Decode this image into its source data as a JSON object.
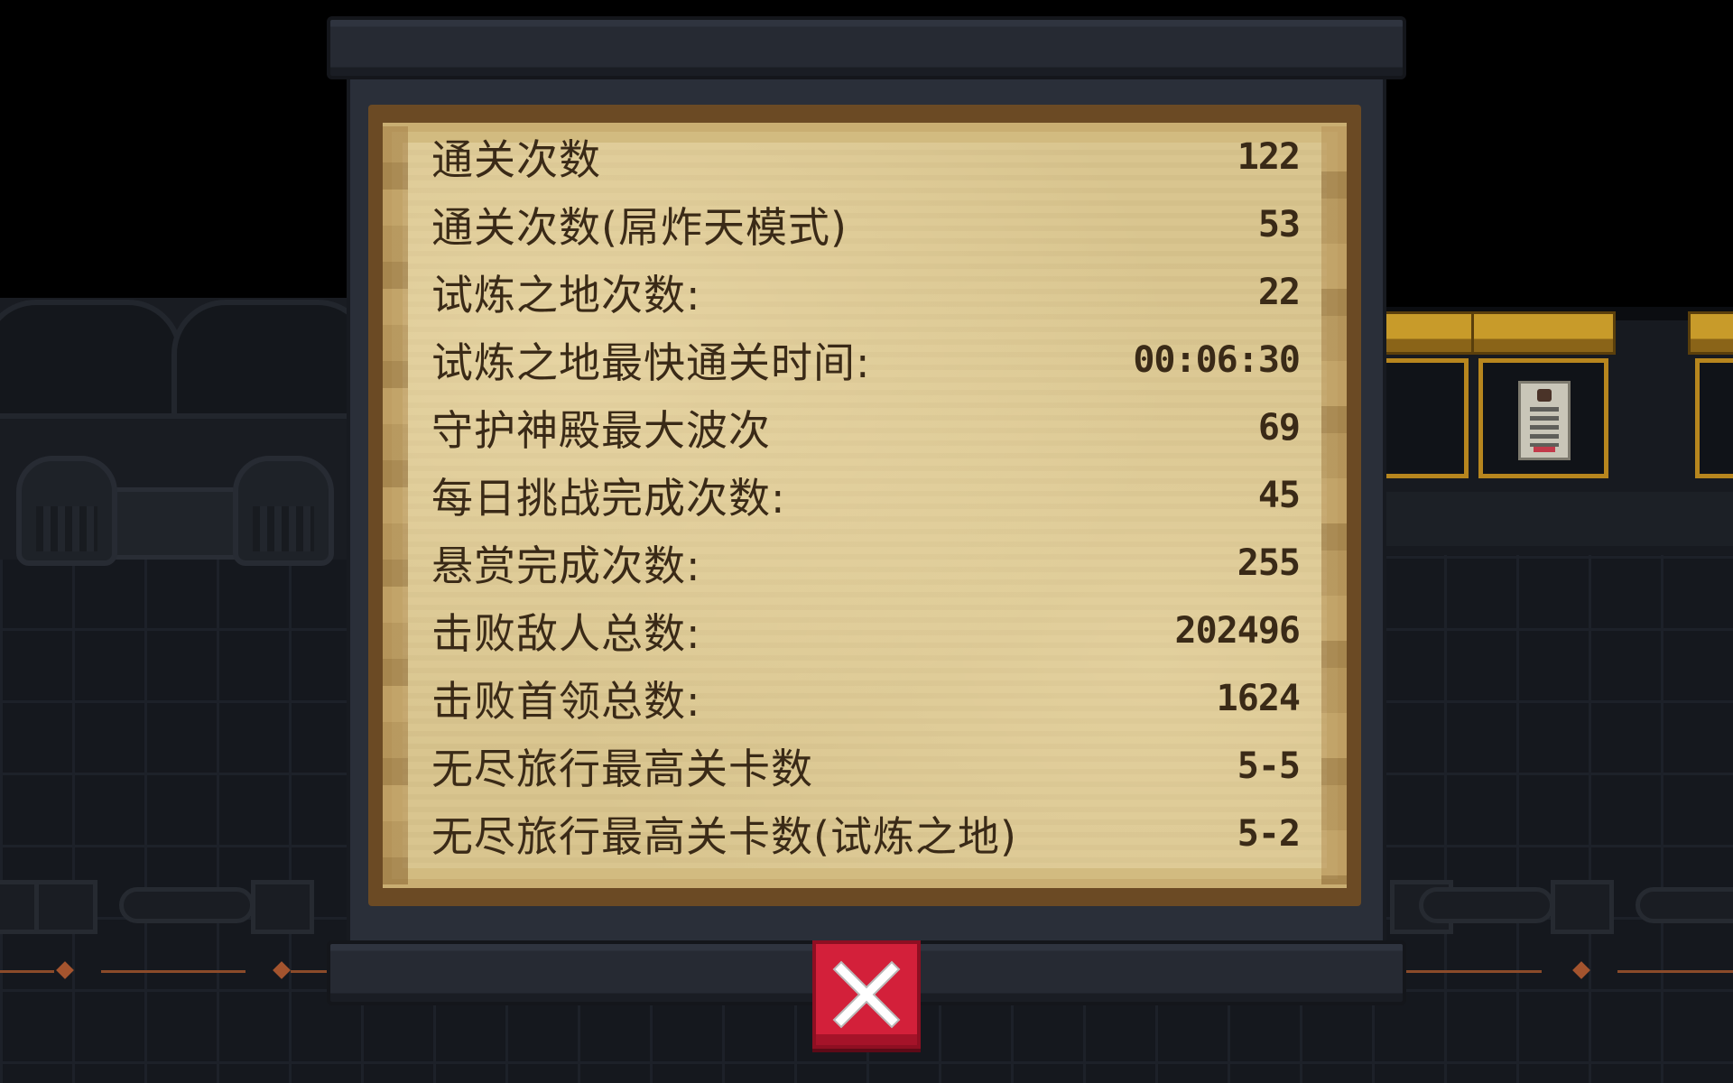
{
  "stats": [
    {
      "label": "通关次数",
      "value": "122"
    },
    {
      "label": "通关次数(屌炸天模式)",
      "value": "53"
    },
    {
      "label": "试炼之地次数:",
      "value": "22"
    },
    {
      "label": "试炼之地最快通关时间:",
      "value": "00:06:30"
    },
    {
      "label": "守护神殿最大波次",
      "value": "69"
    },
    {
      "label": "每日挑战完成次数:",
      "value": "45"
    },
    {
      "label": "悬赏完成次数:",
      "value": "255"
    },
    {
      "label": "击败敌人总数:",
      "value": "202496"
    },
    {
      "label": "击败首领总数:",
      "value": "1624"
    },
    {
      "label": "无尽旅行最高关卡数",
      "value": "5-5"
    },
    {
      "label": "无尽旅行最高关卡数(试炼之地)",
      "value": "5-2"
    }
  ],
  "close_button": {
    "icon": "close-icon"
  },
  "colors": {
    "parchment": "#d9c58f",
    "text": "#3a2a17",
    "close": "#d3203a",
    "panel": "#2a2f39"
  }
}
